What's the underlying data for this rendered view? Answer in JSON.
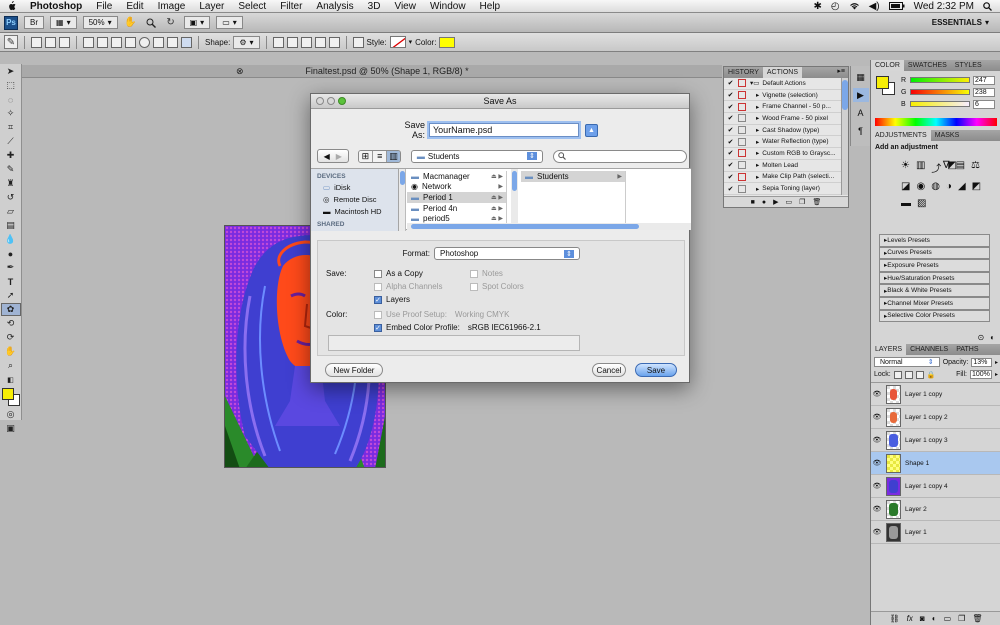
{
  "menubar": {
    "apple": "",
    "app": "Photoshop",
    "items": [
      "File",
      "Edit",
      "Image",
      "Layer",
      "Select",
      "Filter",
      "Analysis",
      "3D",
      "View",
      "Window",
      "Help"
    ],
    "clock": "Wed 2:32 PM"
  },
  "appbar": {
    "zoom": "50%",
    "workspace": "ESSENTIALS"
  },
  "options": {
    "shape_label": "Shape:",
    "style_label": "Style:",
    "color_label": "Color:",
    "color_swatch": "#ffff00"
  },
  "document": {
    "tab_title": "Finaltest.psd @ 50% (Shape 1, RGB/8) *"
  },
  "actions_panel": {
    "tabs": [
      "HISTORY",
      "ACTIONS"
    ],
    "items": [
      {
        "label": "Default Actions",
        "folder": true
      },
      {
        "label": "Vignette (selection)"
      },
      {
        "label": "Frame Channel - 50 p..."
      },
      {
        "label": "Wood Frame - 50 pixel"
      },
      {
        "label": "Cast Shadow (type)"
      },
      {
        "label": "Water Reflection (type)"
      },
      {
        "label": "Custom RGB to Graysc..."
      },
      {
        "label": "Molten Lead"
      },
      {
        "label": "Make Clip Path (selecti..."
      },
      {
        "label": "Sepia Toning (layer)"
      }
    ]
  },
  "color_panel": {
    "tabs": [
      "COLOR",
      "SWATCHES",
      "STYLES"
    ],
    "r_label": "R",
    "r": "247",
    "g_label": "G",
    "g": "238",
    "b_label": "B",
    "b": "6",
    "fg_color": "#f7ee06"
  },
  "adjustments_panel": {
    "tabs": [
      "ADJUSTMENTS",
      "MASKS"
    ],
    "heading": "Add an adjustment",
    "presets": [
      "Levels Presets",
      "Curves Presets",
      "Exposure Presets",
      "Hue/Saturation Presets",
      "Black & White Presets",
      "Channel Mixer Presets",
      "Selective Color Presets"
    ]
  },
  "layers_panel": {
    "tabs": [
      "LAYERS",
      "CHANNELS",
      "PATHS"
    ],
    "blend_mode": "Normal",
    "opacity_label": "Opacity:",
    "opacity": "13%",
    "lock_label": "Lock:",
    "fill_label": "Fill:",
    "fill": "100%",
    "layers": [
      {
        "name": "Layer 1 copy",
        "selected": false
      },
      {
        "name": "Layer 1 copy 2",
        "selected": false
      },
      {
        "name": "Layer 1 copy 3",
        "selected": false
      },
      {
        "name": "Shape 1",
        "selected": true
      },
      {
        "name": "Layer 1 copy 4",
        "selected": false
      },
      {
        "name": "Layer 2",
        "selected": false
      },
      {
        "name": "Layer 1",
        "selected": false
      }
    ]
  },
  "dialog": {
    "title": "Save As",
    "save_as_label": "Save As:",
    "filename": "YourName.psd",
    "location": "Students",
    "search_placeholder": "",
    "sidebar": {
      "devices_heading": "DEVICES",
      "devices": [
        "iDisk",
        "Remote Disc",
        "Macintosh HD"
      ],
      "shared_heading": "SHARED"
    },
    "column1": [
      "Macmanager",
      "Network",
      "Period 1",
      "Period 4n",
      "period5"
    ],
    "column2": [
      "Students"
    ],
    "format_label": "Format:",
    "format_value": "Photoshop",
    "save_label": "Save:",
    "options": {
      "as_copy": "As a Copy",
      "notes": "Notes",
      "alpha": "Alpha Channels",
      "spot": "Spot Colors",
      "layers": "Layers"
    },
    "color_label": "Color:",
    "proof_setup": "Use Proof Setup:",
    "proof_value": "Working CMYK",
    "embed_profile": "Embed Color Profile:",
    "profile_value": "sRGB IEC61966-2.1",
    "new_folder": "New Folder",
    "cancel": "Cancel",
    "save": "Save"
  }
}
